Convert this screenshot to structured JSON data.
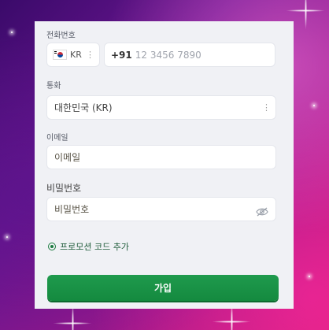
{
  "form": {
    "phone": {
      "label": "전화번호",
      "country_code": "KR",
      "dial_code": "+91",
      "placeholder": "12 3456 7890"
    },
    "currency": {
      "label": "통화",
      "selected": "대한민국 (KR)"
    },
    "email": {
      "label": "이메일",
      "placeholder": "이메일"
    },
    "password": {
      "label": "비밀번호",
      "placeholder": "비밀번호"
    },
    "promo": {
      "label": "프로모션 코드 추가"
    },
    "submit_label": "가입"
  },
  "icons": {
    "flag": "south-korea-flag",
    "menu": "vertical-dots-icon",
    "password_toggle": "eye-off-icon"
  },
  "colors": {
    "primary_button": "#148a3f",
    "form_background": "#f0f1f5"
  }
}
